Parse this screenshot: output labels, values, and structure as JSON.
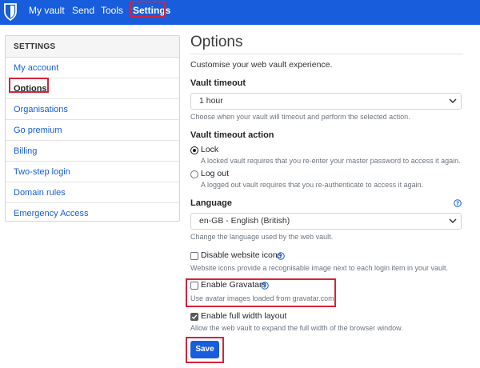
{
  "nav": {
    "logo_icon": "bitwarden-shield-icon",
    "my_vault": "My vault",
    "send": "Send",
    "tools": "Tools",
    "settings": "Settings"
  },
  "sidebar": {
    "header": "SETTINGS",
    "items": [
      {
        "label": "My account"
      },
      {
        "label": "Options"
      },
      {
        "label": "Organisations"
      },
      {
        "label": "Go premium"
      },
      {
        "label": "Billing"
      },
      {
        "label": "Two-step login"
      },
      {
        "label": "Domain rules"
      },
      {
        "label": "Emergency Access"
      }
    ],
    "active_index": 1
  },
  "options": {
    "title": "Options",
    "subtitle": "Customise your web vault experience.",
    "vault_timeout": {
      "label": "Vault timeout",
      "value": "1 hour",
      "help": "Choose when your vault will timeout and perform the selected action."
    },
    "vault_timeout_action": {
      "label": "Vault timeout action",
      "lock_label": "Lock",
      "lock_help": "A locked vault requires that you re-enter your master password to access it again.",
      "logout_label": "Log out",
      "logout_help": "A logged out vault requires that you re-authenticate to access it again.",
      "selected": "Lock"
    },
    "language": {
      "label": "Language",
      "value": "en-GB - English (British)",
      "help": "Change the language used by the web vault."
    },
    "disable_icons": {
      "label": "Disable website icons",
      "help": "Website icons provide a recognisable image next to each login item in your vault.",
      "checked": false
    },
    "gravatars": {
      "label": "Enable Gravatars",
      "help": "Use avatar images loaded from gravatar.com.",
      "checked": false
    },
    "full_width": {
      "label": "Enable full width layout",
      "help": "Allow the web vault to expand the full width of the browser window.",
      "checked": true
    },
    "save_label": "Save"
  },
  "colors": {
    "brand": "#175ddc",
    "highlight": "#d4243b"
  }
}
